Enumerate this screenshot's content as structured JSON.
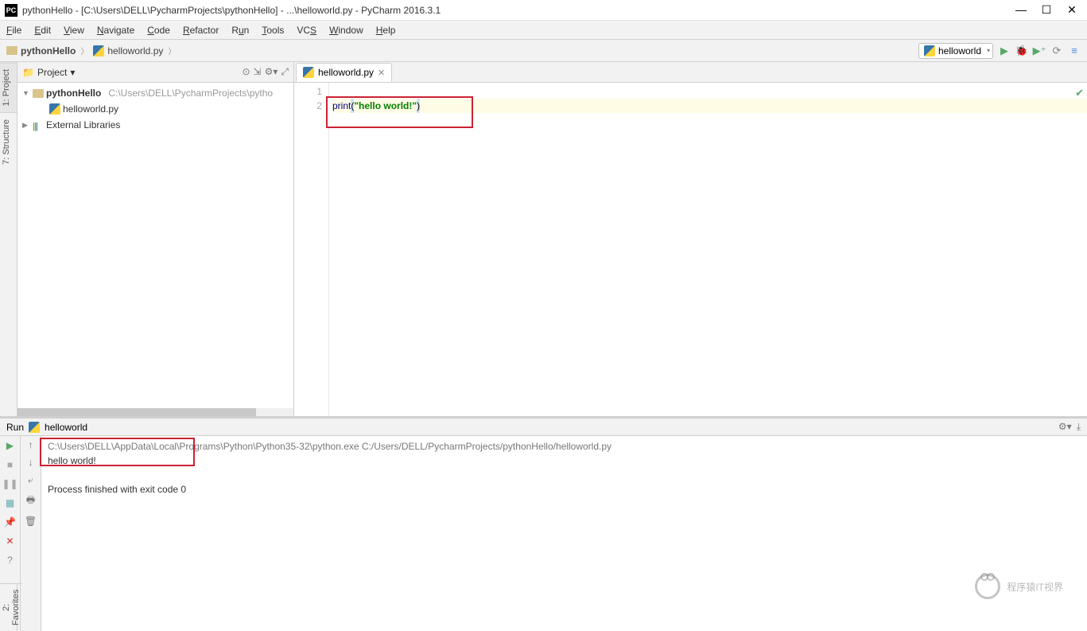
{
  "title": "pythonHello - [C:\\Users\\DELL\\PycharmProjects\\pythonHello] - ...\\helloworld.py - PyCharm 2016.3.1",
  "menu": [
    "File",
    "Edit",
    "View",
    "Navigate",
    "Code",
    "Refactor",
    "Run",
    "Tools",
    "VCS",
    "Window",
    "Help"
  ],
  "breadcrumb": {
    "project": "pythonHello",
    "file": "helloworld.py"
  },
  "runConfig": "helloworld",
  "project": {
    "panelTitle": "Project",
    "root": "pythonHello",
    "rootPath": "C:\\Users\\DELL\\PycharmProjects\\pytho",
    "file": "helloworld.py",
    "ext": "External Libraries"
  },
  "sideTabs": {
    "project": "1: Project",
    "structure": "7: Structure",
    "favorites": "2: Favorites"
  },
  "editor": {
    "tab": "helloworld.py",
    "lines": {
      "l1": "1",
      "l2": "2"
    },
    "code_kw": "print",
    "code_p1": "(",
    "code_str": "\"hello world!\"",
    "code_p2": ")"
  },
  "run": {
    "label": "Run",
    "config": "helloworld",
    "path": "C:\\Users\\DELL\\AppData\\Local\\Programs\\Python\\Python35-32\\python.exe C:/Users/DELL/PycharmProjects/pythonHello/helloworld.py",
    "out": "hello world!",
    "exit": "Process finished with exit code 0"
  },
  "watermark": "程序猿IT视界"
}
